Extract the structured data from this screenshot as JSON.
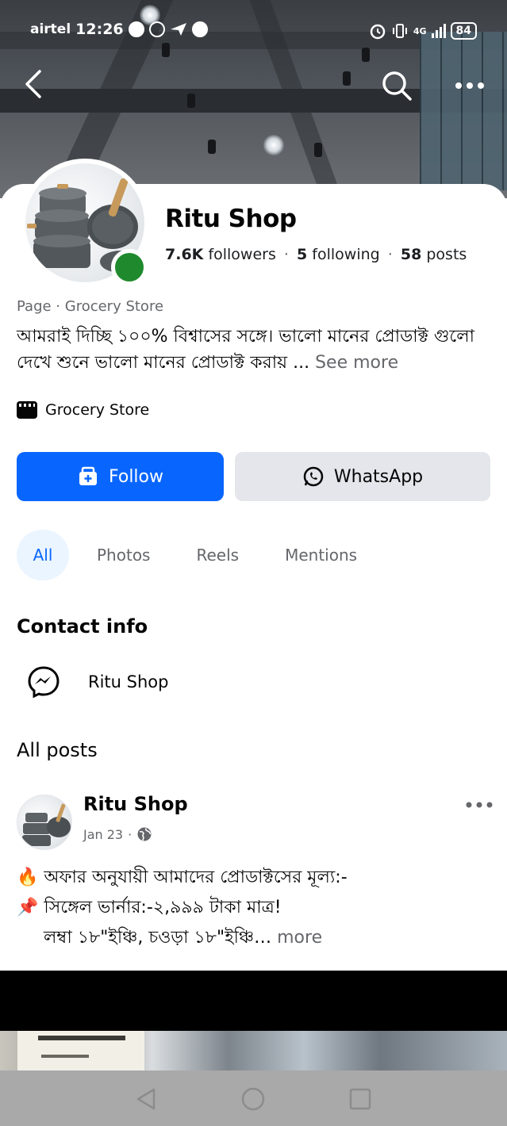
{
  "status_bar": {
    "carrier": "airtel",
    "time": "12:26",
    "network": "4G",
    "battery": "84"
  },
  "page": {
    "name": "Ritu Shop",
    "followers": "7.6K",
    "followers_label": "followers",
    "following": "5",
    "following_label": "following",
    "posts": "58",
    "posts_label": "posts",
    "category_line": "Page · Grocery Store",
    "bio": "আমরাই দিচ্ছি ১০০% বিশ্বাসের সঙ্গে। ভালো মানের প্রোডাক্ট গুলো দেখে শুনে ভালো মানের প্রোডাক্ট করায় ...",
    "see_more": "See more",
    "category": "Grocery Store"
  },
  "actions": {
    "follow": "Follow",
    "whatsapp": "WhatsApp"
  },
  "tabs": [
    {
      "label": "All",
      "active": true
    },
    {
      "label": "Photos",
      "active": false
    },
    {
      "label": "Reels",
      "active": false
    },
    {
      "label": "Mentions",
      "active": false
    }
  ],
  "contact": {
    "heading": "Contact info",
    "messenger_name": "Ritu Shop"
  },
  "posts_section": {
    "heading": "All posts"
  },
  "post": {
    "author": "Ritu Shop",
    "date": "Jan 23",
    "line1_emoji": "🔥",
    "line1": "অফার অনুযায়ী আমাদের প্রোডাক্টসের মূল্য:-",
    "line2_emoji": "📌",
    "line2": "সিঙ্গেল ভার্নার:-২,৯৯৯ টাকা মাত্র!",
    "line3": "লম্বা ১৮\"ইঞ্চি, চওড়া ১৮\"ইঞ্চি…",
    "more": "more"
  },
  "colors": {
    "primary": "#0866ff",
    "online": "#1f8a2d",
    "secondary_button": "#e4e6eb",
    "muted_text": "#65676b"
  }
}
